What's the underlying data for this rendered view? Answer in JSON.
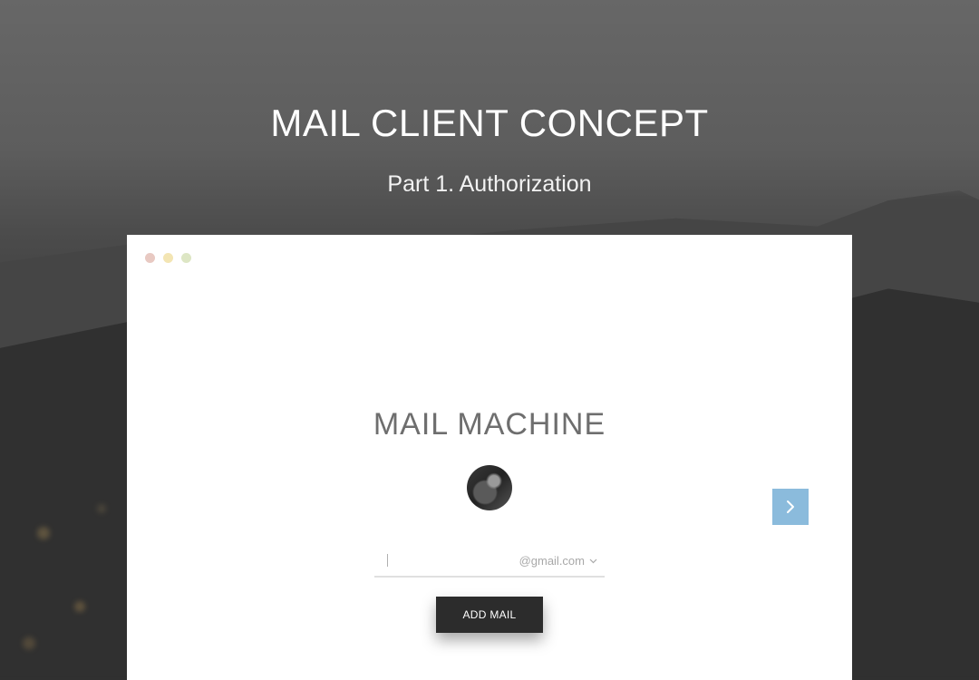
{
  "hero": {
    "title": "MAIL CLIENT CONCEPT",
    "subtitle": "Part 1. Authorization"
  },
  "window": {
    "controls": [
      "close",
      "minimize",
      "maximize"
    ],
    "control_colors": {
      "close": "#e8c9c2",
      "minimize": "#f3e5b3",
      "maximize": "#dde6c4"
    }
  },
  "app": {
    "title": "MAIL MACHINE",
    "avatar": "user-avatar-photo",
    "email_value": "",
    "domain": "@gmail.com",
    "add_button_label": "ADD MAIL",
    "next_icon": "chevron-right-icon"
  },
  "colors": {
    "accent": "#8bbbdc",
    "button_dark": "#2c2c2c",
    "title_gray": "#6e6e6e"
  }
}
